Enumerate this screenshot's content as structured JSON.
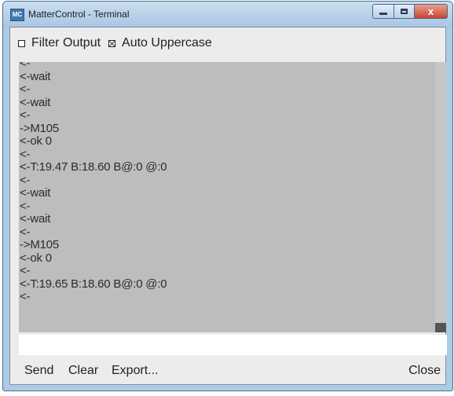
{
  "window": {
    "title": "MatterControl - Terminal",
    "icon_text": "MC",
    "controls": {
      "close_glyph": "x"
    }
  },
  "options": {
    "filter_output": {
      "label": "Filter Output",
      "checked": false
    },
    "auto_uppercase": {
      "label": "Auto Uppercase",
      "checked": true
    }
  },
  "output": {
    "lines": [
      "<-",
      "<-wait",
      "<-",
      "<-wait",
      "<-",
      "->M105",
      "<-ok 0",
      "<-",
      "<-T:19.47 B:18.60 B@:0 @:0",
      "<-",
      "<-wait",
      "<-",
      "<-wait",
      "<-",
      "->M105",
      "<-ok 0",
      "<-",
      "<-T:19.65 B:18.60 B@:0 @:0",
      "<-"
    ]
  },
  "command": {
    "value": "",
    "placeholder": ""
  },
  "buttons": {
    "send": "Send",
    "clear": "Clear",
    "export": "Export...",
    "close": "Close"
  }
}
